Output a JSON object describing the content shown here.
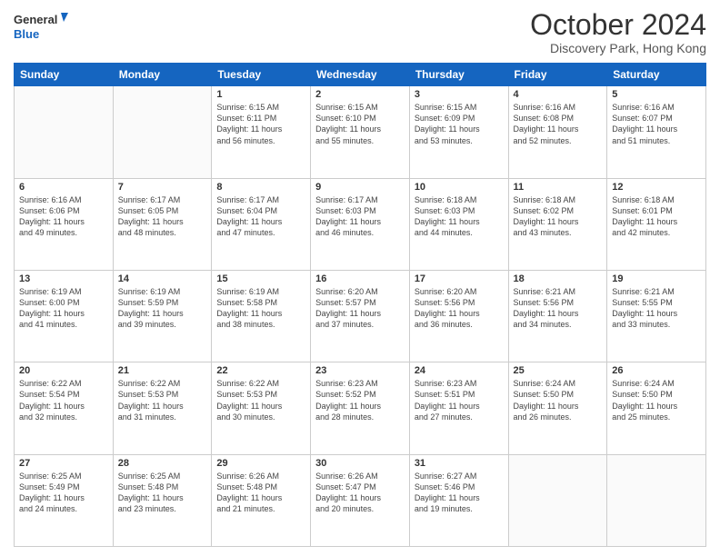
{
  "header": {
    "logo_line1": "General",
    "logo_line2": "Blue",
    "month_title": "October 2024",
    "location": "Discovery Park, Hong Kong"
  },
  "days_of_week": [
    "Sunday",
    "Monday",
    "Tuesday",
    "Wednesday",
    "Thursday",
    "Friday",
    "Saturday"
  ],
  "weeks": [
    [
      {
        "day": "",
        "info": ""
      },
      {
        "day": "",
        "info": ""
      },
      {
        "day": "1",
        "info": "Sunrise: 6:15 AM\nSunset: 6:11 PM\nDaylight: 11 hours\nand 56 minutes."
      },
      {
        "day": "2",
        "info": "Sunrise: 6:15 AM\nSunset: 6:10 PM\nDaylight: 11 hours\nand 55 minutes."
      },
      {
        "day": "3",
        "info": "Sunrise: 6:15 AM\nSunset: 6:09 PM\nDaylight: 11 hours\nand 53 minutes."
      },
      {
        "day": "4",
        "info": "Sunrise: 6:16 AM\nSunset: 6:08 PM\nDaylight: 11 hours\nand 52 minutes."
      },
      {
        "day": "5",
        "info": "Sunrise: 6:16 AM\nSunset: 6:07 PM\nDaylight: 11 hours\nand 51 minutes."
      }
    ],
    [
      {
        "day": "6",
        "info": "Sunrise: 6:16 AM\nSunset: 6:06 PM\nDaylight: 11 hours\nand 49 minutes."
      },
      {
        "day": "7",
        "info": "Sunrise: 6:17 AM\nSunset: 6:05 PM\nDaylight: 11 hours\nand 48 minutes."
      },
      {
        "day": "8",
        "info": "Sunrise: 6:17 AM\nSunset: 6:04 PM\nDaylight: 11 hours\nand 47 minutes."
      },
      {
        "day": "9",
        "info": "Sunrise: 6:17 AM\nSunset: 6:03 PM\nDaylight: 11 hours\nand 46 minutes."
      },
      {
        "day": "10",
        "info": "Sunrise: 6:18 AM\nSunset: 6:03 PM\nDaylight: 11 hours\nand 44 minutes."
      },
      {
        "day": "11",
        "info": "Sunrise: 6:18 AM\nSunset: 6:02 PM\nDaylight: 11 hours\nand 43 minutes."
      },
      {
        "day": "12",
        "info": "Sunrise: 6:18 AM\nSunset: 6:01 PM\nDaylight: 11 hours\nand 42 minutes."
      }
    ],
    [
      {
        "day": "13",
        "info": "Sunrise: 6:19 AM\nSunset: 6:00 PM\nDaylight: 11 hours\nand 41 minutes."
      },
      {
        "day": "14",
        "info": "Sunrise: 6:19 AM\nSunset: 5:59 PM\nDaylight: 11 hours\nand 39 minutes."
      },
      {
        "day": "15",
        "info": "Sunrise: 6:19 AM\nSunset: 5:58 PM\nDaylight: 11 hours\nand 38 minutes."
      },
      {
        "day": "16",
        "info": "Sunrise: 6:20 AM\nSunset: 5:57 PM\nDaylight: 11 hours\nand 37 minutes."
      },
      {
        "day": "17",
        "info": "Sunrise: 6:20 AM\nSunset: 5:56 PM\nDaylight: 11 hours\nand 36 minutes."
      },
      {
        "day": "18",
        "info": "Sunrise: 6:21 AM\nSunset: 5:56 PM\nDaylight: 11 hours\nand 34 minutes."
      },
      {
        "day": "19",
        "info": "Sunrise: 6:21 AM\nSunset: 5:55 PM\nDaylight: 11 hours\nand 33 minutes."
      }
    ],
    [
      {
        "day": "20",
        "info": "Sunrise: 6:22 AM\nSunset: 5:54 PM\nDaylight: 11 hours\nand 32 minutes."
      },
      {
        "day": "21",
        "info": "Sunrise: 6:22 AM\nSunset: 5:53 PM\nDaylight: 11 hours\nand 31 minutes."
      },
      {
        "day": "22",
        "info": "Sunrise: 6:22 AM\nSunset: 5:53 PM\nDaylight: 11 hours\nand 30 minutes."
      },
      {
        "day": "23",
        "info": "Sunrise: 6:23 AM\nSunset: 5:52 PM\nDaylight: 11 hours\nand 28 minutes."
      },
      {
        "day": "24",
        "info": "Sunrise: 6:23 AM\nSunset: 5:51 PM\nDaylight: 11 hours\nand 27 minutes."
      },
      {
        "day": "25",
        "info": "Sunrise: 6:24 AM\nSunset: 5:50 PM\nDaylight: 11 hours\nand 26 minutes."
      },
      {
        "day": "26",
        "info": "Sunrise: 6:24 AM\nSunset: 5:50 PM\nDaylight: 11 hours\nand 25 minutes."
      }
    ],
    [
      {
        "day": "27",
        "info": "Sunrise: 6:25 AM\nSunset: 5:49 PM\nDaylight: 11 hours\nand 24 minutes."
      },
      {
        "day": "28",
        "info": "Sunrise: 6:25 AM\nSunset: 5:48 PM\nDaylight: 11 hours\nand 23 minutes."
      },
      {
        "day": "29",
        "info": "Sunrise: 6:26 AM\nSunset: 5:48 PM\nDaylight: 11 hours\nand 21 minutes."
      },
      {
        "day": "30",
        "info": "Sunrise: 6:26 AM\nSunset: 5:47 PM\nDaylight: 11 hours\nand 20 minutes."
      },
      {
        "day": "31",
        "info": "Sunrise: 6:27 AM\nSunset: 5:46 PM\nDaylight: 11 hours\nand 19 minutes."
      },
      {
        "day": "",
        "info": ""
      },
      {
        "day": "",
        "info": ""
      }
    ]
  ]
}
